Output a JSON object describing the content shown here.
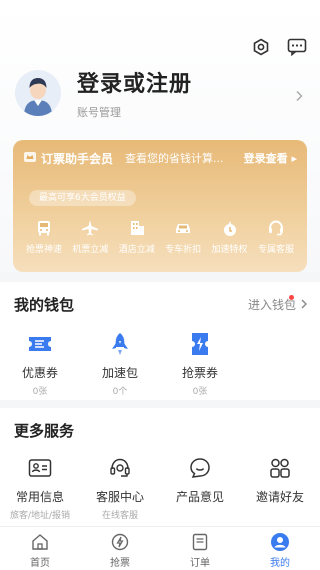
{
  "header": {
    "icons": [
      "settings-icon",
      "message-icon"
    ]
  },
  "profile": {
    "title": "登录或注册",
    "subtitle": "账号管理"
  },
  "vip": {
    "title": "订票助手会员",
    "savings": "查看您的省钱计算...",
    "login": "登录查看 ▸",
    "pill": "最高可享6大会员权益",
    "perks": [
      {
        "label": "抢票神速",
        "icon": "bus-icon"
      },
      {
        "label": "机票立减",
        "icon": "plane-icon"
      },
      {
        "label": "酒店立减",
        "icon": "hotel-icon"
      },
      {
        "label": "专车折扣",
        "icon": "car-icon"
      },
      {
        "label": "加速特权",
        "icon": "rocket-icon"
      },
      {
        "label": "专属客服",
        "icon": "headset-icon"
      }
    ]
  },
  "wallet": {
    "title": "我的钱包",
    "link": "进入钱包",
    "items": [
      {
        "label": "优惠券",
        "count": "0张"
      },
      {
        "label": "加速包",
        "count": "0个"
      },
      {
        "label": "抢票券",
        "count": "0张"
      }
    ]
  },
  "services": {
    "title": "更多服务",
    "items": [
      {
        "label": "常用信息",
        "desc": "旅客/地址/报销"
      },
      {
        "label": "客服中心",
        "desc": "在线客服"
      },
      {
        "label": "产品意见",
        "desc": ""
      },
      {
        "label": "邀请好友",
        "desc": ""
      }
    ]
  },
  "tabbar": {
    "tabs": [
      {
        "label": "首页"
      },
      {
        "label": "抢票"
      },
      {
        "label": "订单"
      },
      {
        "label": "我的"
      }
    ]
  },
  "colors": {
    "accent": "#3a7bf0",
    "vip_gold": "#e7b977",
    "badge": "#ff4444"
  }
}
